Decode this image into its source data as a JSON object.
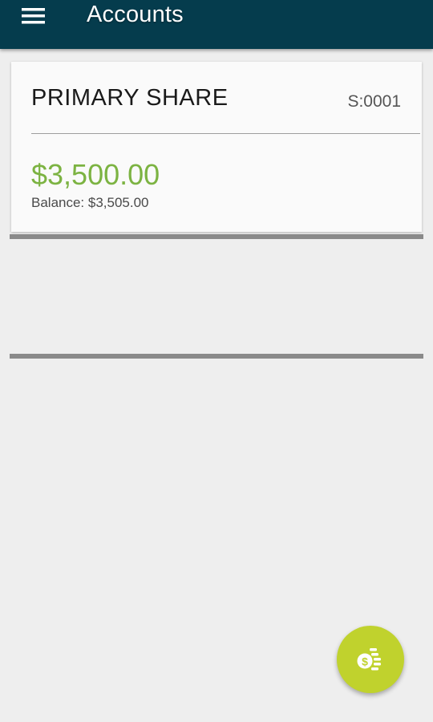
{
  "app_bar": {
    "title": "Accounts",
    "menu_icon": "hamburger-menu-icon",
    "background_color": "#053c4d"
  },
  "accounts": [
    {
      "name": "PRIMARY SHARE",
      "id": "S:0001",
      "available": "$3,500.00",
      "balance": "Balance: $3,505.00",
      "available_color": "#7cb342"
    }
  ],
  "fab": {
    "icon": "coins-transfer-icon",
    "color": "#c0d22d"
  }
}
